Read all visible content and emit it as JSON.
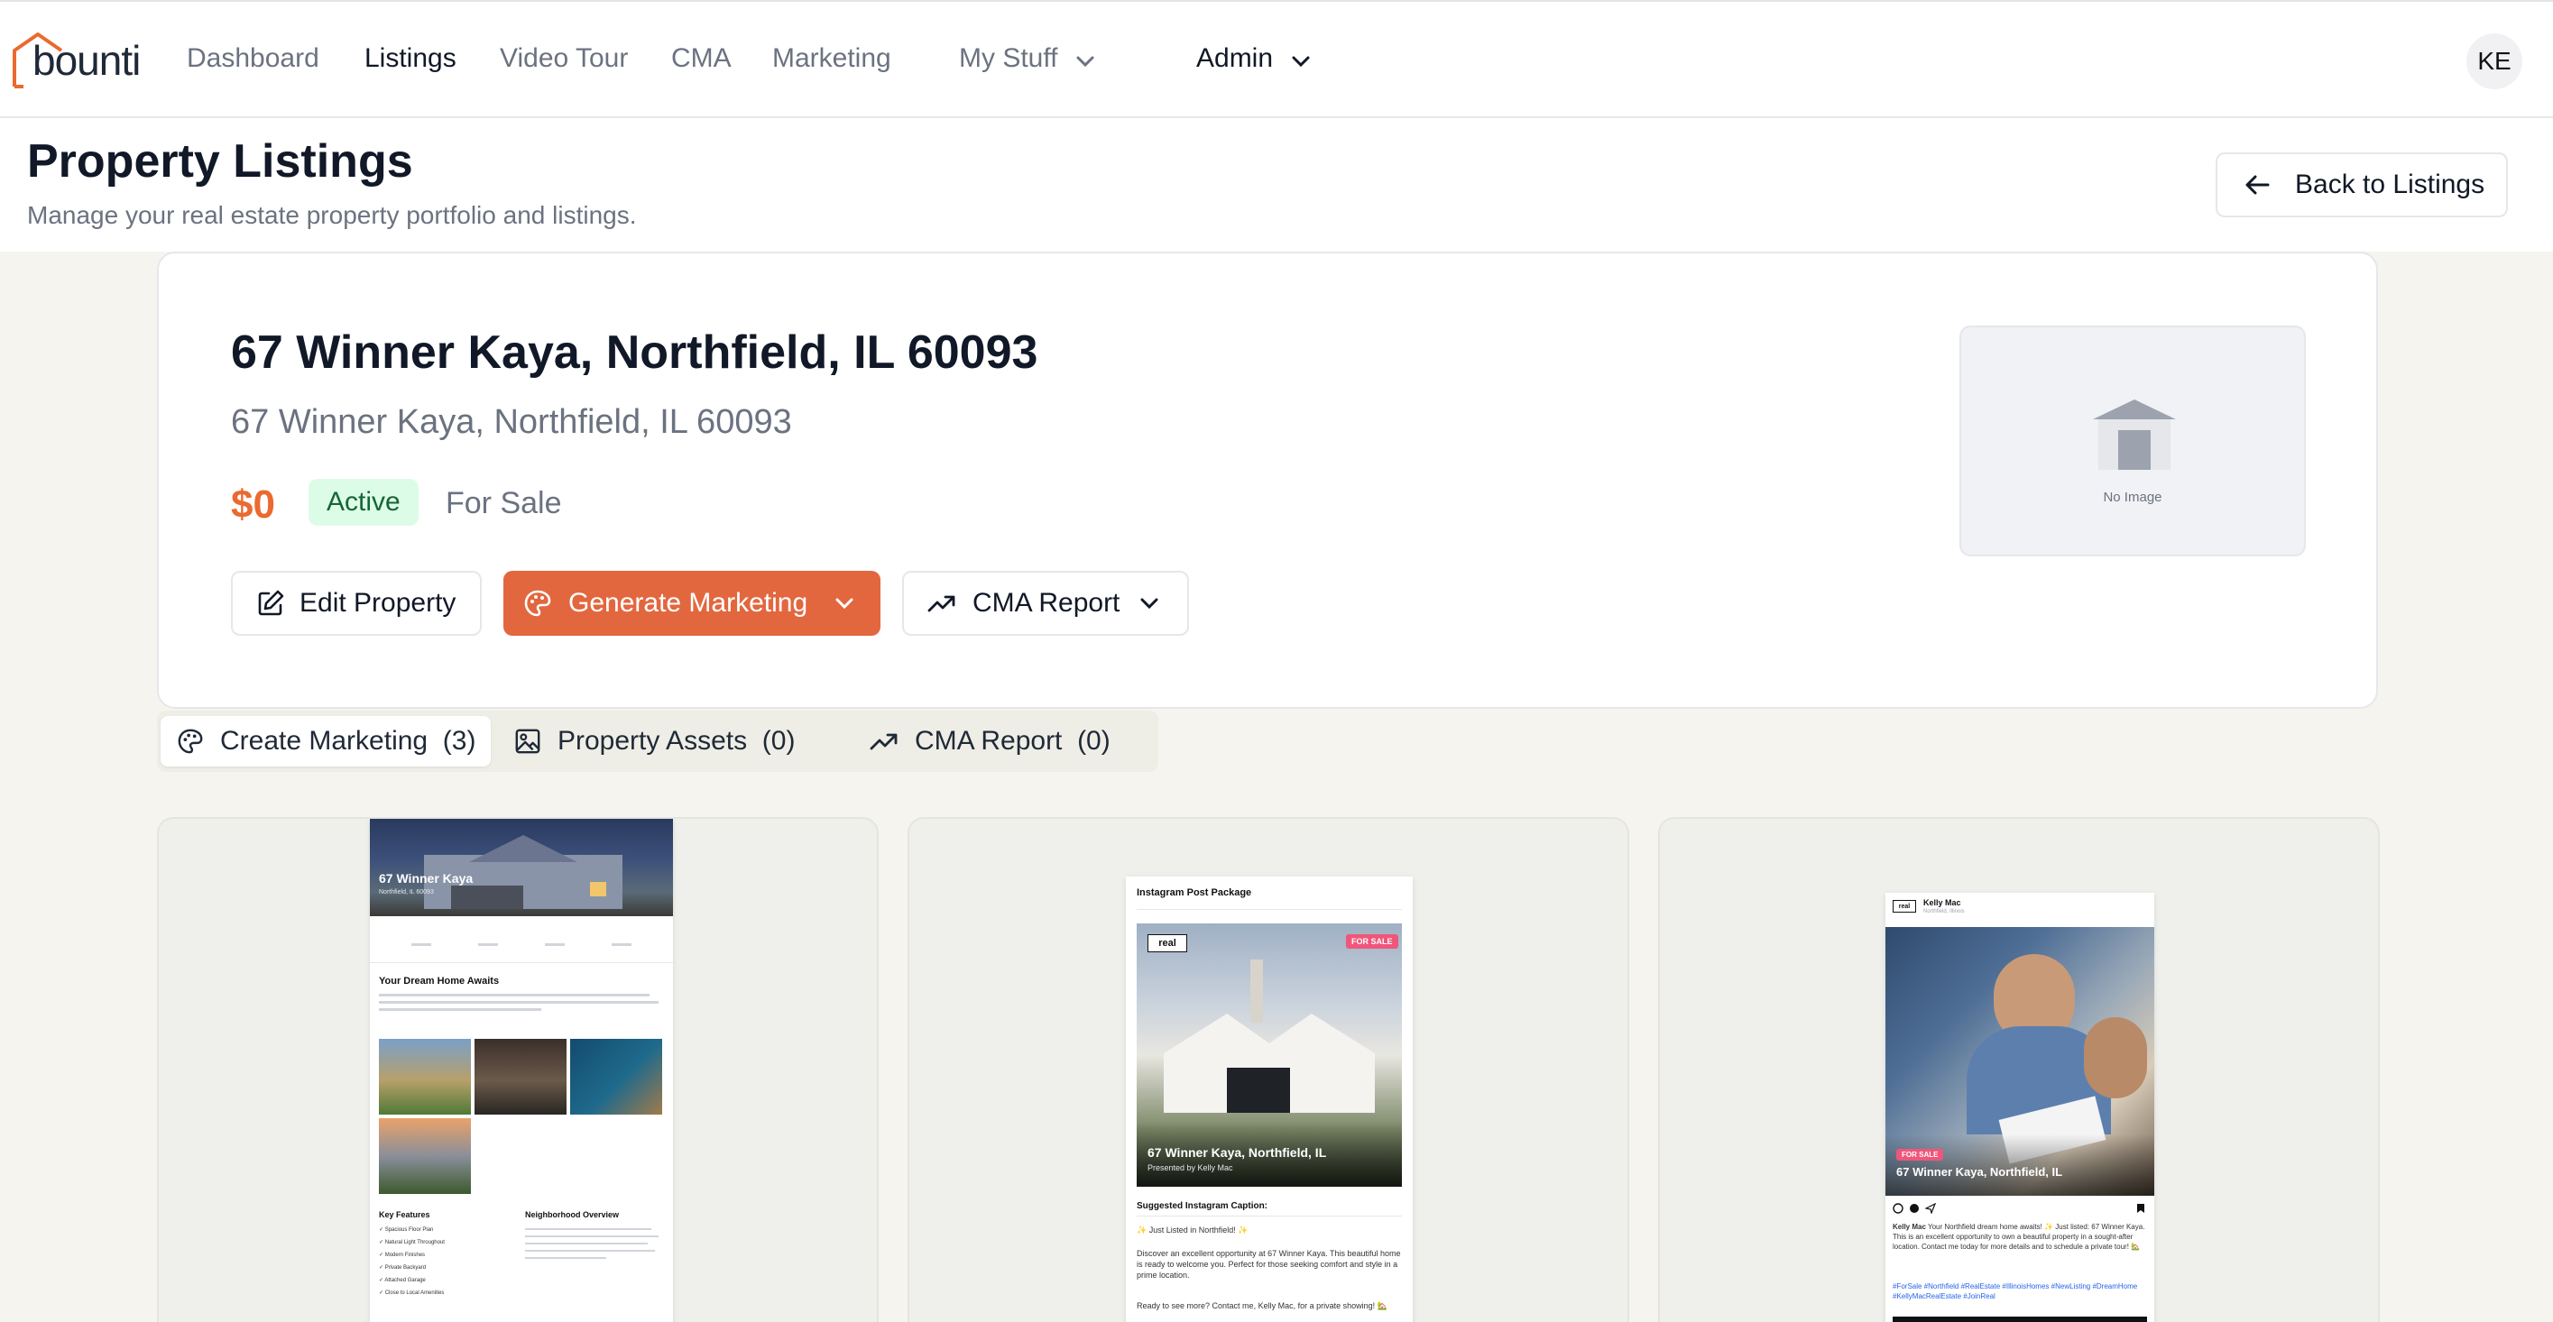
{
  "brand": {
    "name": "bounti",
    "accent": "#e2673f",
    "price_color": "#ea6a2f"
  },
  "nav": {
    "items": [
      "Dashboard",
      "Listings",
      "Video Tour",
      "CMA",
      "Marketing"
    ],
    "my_stuff": "My Stuff",
    "admin": "Admin",
    "avatar_initials": "KE"
  },
  "header": {
    "title": "Property Listings",
    "subtitle": "Manage your real estate property portfolio and listings.",
    "back_button": "Back to Listings"
  },
  "property": {
    "title": "67 Winner Kaya, Northfield, IL 60093",
    "address": "67 Winner Kaya, Northfield, IL 60093",
    "price": "$0",
    "status_badge": "Active",
    "listing_type": "For Sale",
    "no_image_label": "No Image",
    "actions": {
      "edit": "Edit Property",
      "generate": "Generate Marketing",
      "cma": "CMA Report"
    }
  },
  "tabs": [
    {
      "label": "Create Marketing",
      "count": "(3)"
    },
    {
      "label": "Property Assets",
      "count": "(0)"
    },
    {
      "label": "CMA Report",
      "count": "(0)"
    }
  ],
  "marketing_cards": {
    "flyer": {
      "hero_title": "67 Winner Kaya",
      "hero_sub": "Northfield, IL 60093",
      "section_title": "Your Dream Home Awaits",
      "features_title": "Key Features",
      "features": [
        "Spacious Floor Plan",
        "Natural Light Throughout",
        "Modern Finishes",
        "Private Backyard",
        "Attached Garage",
        "Close to Local Amenities"
      ],
      "neighborhood_title": "Neighborhood Overview"
    },
    "instagram": {
      "package_title": "Instagram Post Package",
      "logo": "real",
      "for_sale": "FOR SALE",
      "overlay_title": "67 Winner Kaya, Northfield, IL",
      "overlay_sub": "Presented by Kelly Mac",
      "caption_title": "Suggested Instagram Caption:",
      "caption_line1": "✨ Just Listed in Northfield! ✨",
      "caption_body": "Discover an excellent opportunity at 67 Winner Kaya. This beautiful home is ready to welcome you. Perfect for those seeking comfort and style in a prime location.",
      "caption_cta": "Ready to see more? Contact me, Kelly Mac, for a private showing! 🏡"
    },
    "social": {
      "logo": "real",
      "agent": "Kelly Mac",
      "location": "Northfield, Illinois",
      "for_sale": "FOR SALE",
      "overlay_title": "67 Winner Kaya, Northfield, IL",
      "post_author": "Kelly Mac",
      "post_text": "Your Northfield dream home awaits! ✨ Just listed: 67 Winner Kaya. This is an excellent opportunity to own a beautiful property in a sought-after location. Contact me today for more details and to schedule a private tour! 🏡",
      "hashtags": "#ForSale #Northfield #RealEstate #IllinoisHomes #NewListing #DreamHome #KellyMacRealEstate #JoinReal"
    }
  }
}
